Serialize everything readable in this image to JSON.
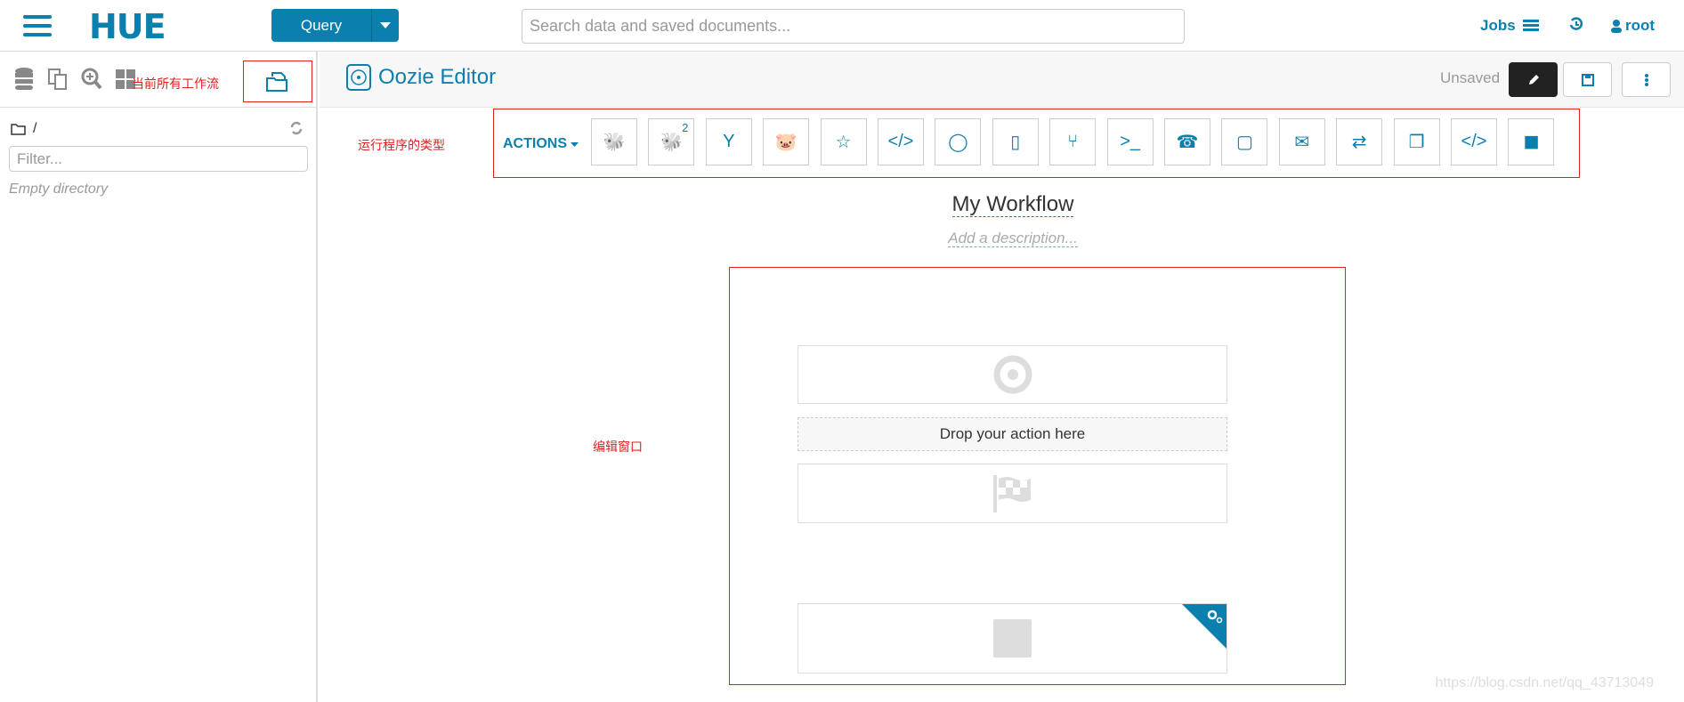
{
  "header": {
    "logo": "HUE",
    "query_label": "Query",
    "search_placeholder": "Search data and saved documents...",
    "jobs_label": "Jobs",
    "user_label": "root"
  },
  "sidebar": {
    "annotation": "当前所有工作流",
    "path": "/",
    "filter_placeholder": "Filter...",
    "empty_text": "Empty directory"
  },
  "editor": {
    "title": "Oozie Editor",
    "status": "Unsaved"
  },
  "actions": {
    "label": "ACTIONS",
    "annotation": "运行程序的类型",
    "items": [
      "hive-icon",
      "hive2-icon",
      "sqoop-icon",
      "pig-icon",
      "spark-icon",
      "java-icon",
      "subworkflow-icon",
      "shell-file-icon",
      "fork-icon",
      "ssh-icon",
      "distcp-icon",
      "fs-icon",
      "email-icon",
      "streaming-icon",
      "generic-copy-icon",
      "xml-icon",
      "kill-icon"
    ],
    "hive2_badge": "2"
  },
  "workflow": {
    "name": "My Workflow",
    "description_placeholder": "Add a description...",
    "drop_text": "Drop your action here",
    "canvas_annotation": "编辑窗口"
  },
  "watermark": "https://blog.csdn.net/qq_43713049",
  "colors": {
    "accent": "#0B7FAD",
    "annotation": "#E02020"
  }
}
